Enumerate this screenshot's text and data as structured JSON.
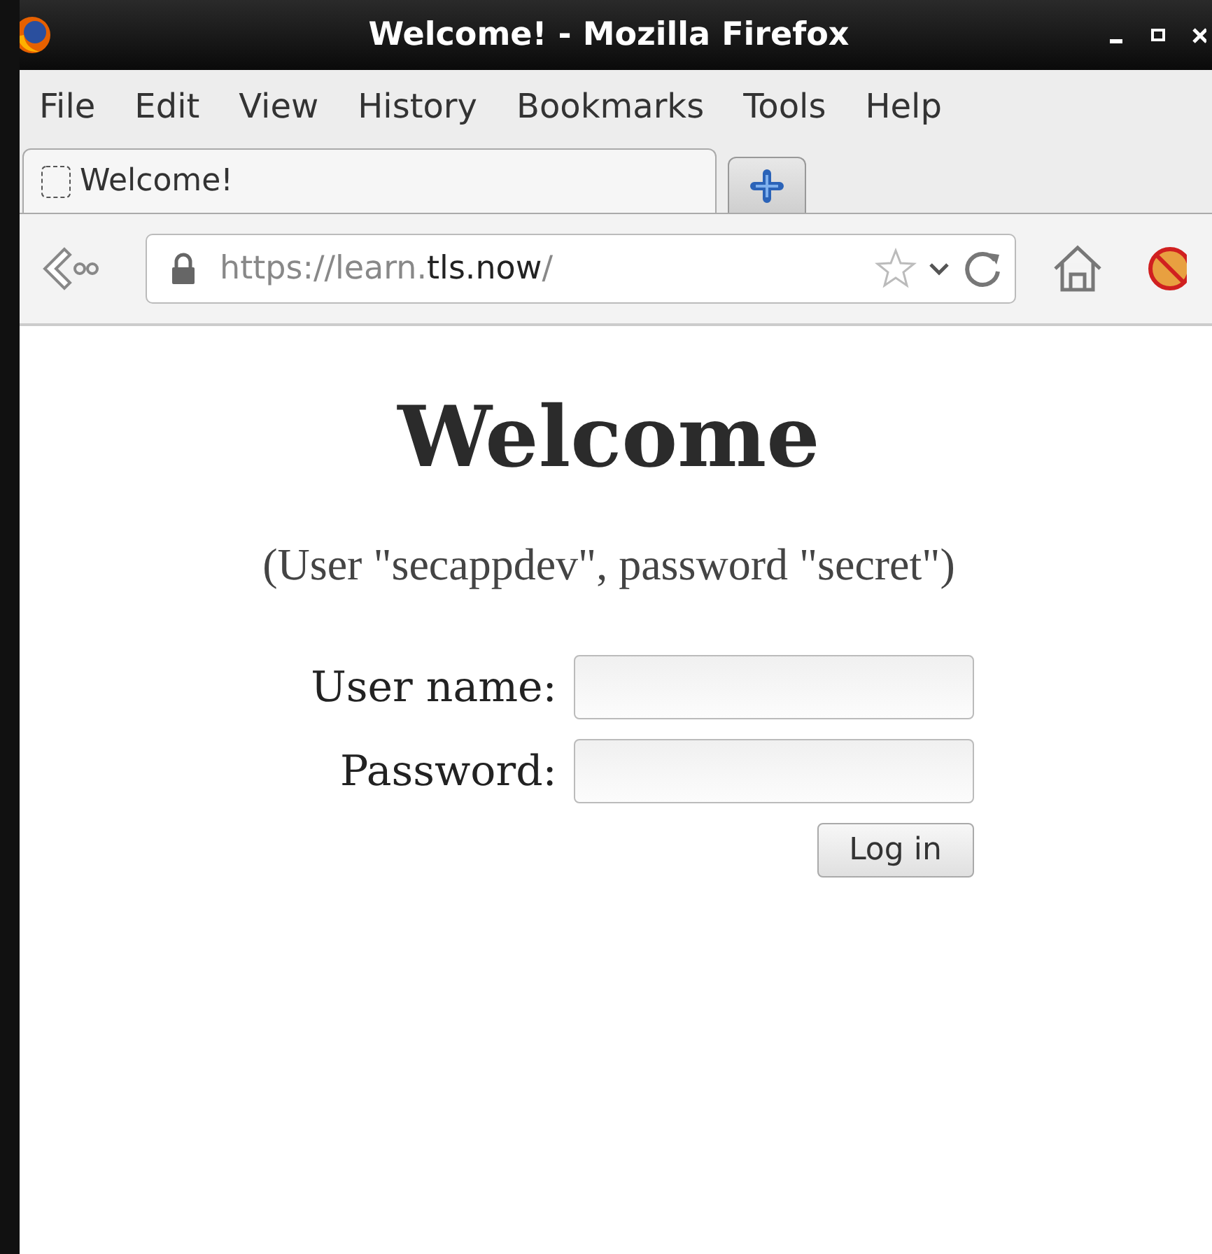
{
  "window": {
    "title": "Welcome! - Mozilla Firefox"
  },
  "menu": [
    "File",
    "Edit",
    "View",
    "History",
    "Bookmarks",
    "Tools",
    "Help"
  ],
  "tabs": [
    {
      "label": "Welcome!",
      "selected": true
    }
  ],
  "address_bar": {
    "url_start": "https://learn.",
    "url_domain": "tls.now",
    "url_end": "/"
  },
  "page": {
    "heading": "Welcome",
    "note": "(User \"secappdev\", password \"secret\")",
    "fields": [
      {
        "label": "User name:"
      },
      {
        "label": "Password:"
      }
    ],
    "button": "Log in"
  }
}
